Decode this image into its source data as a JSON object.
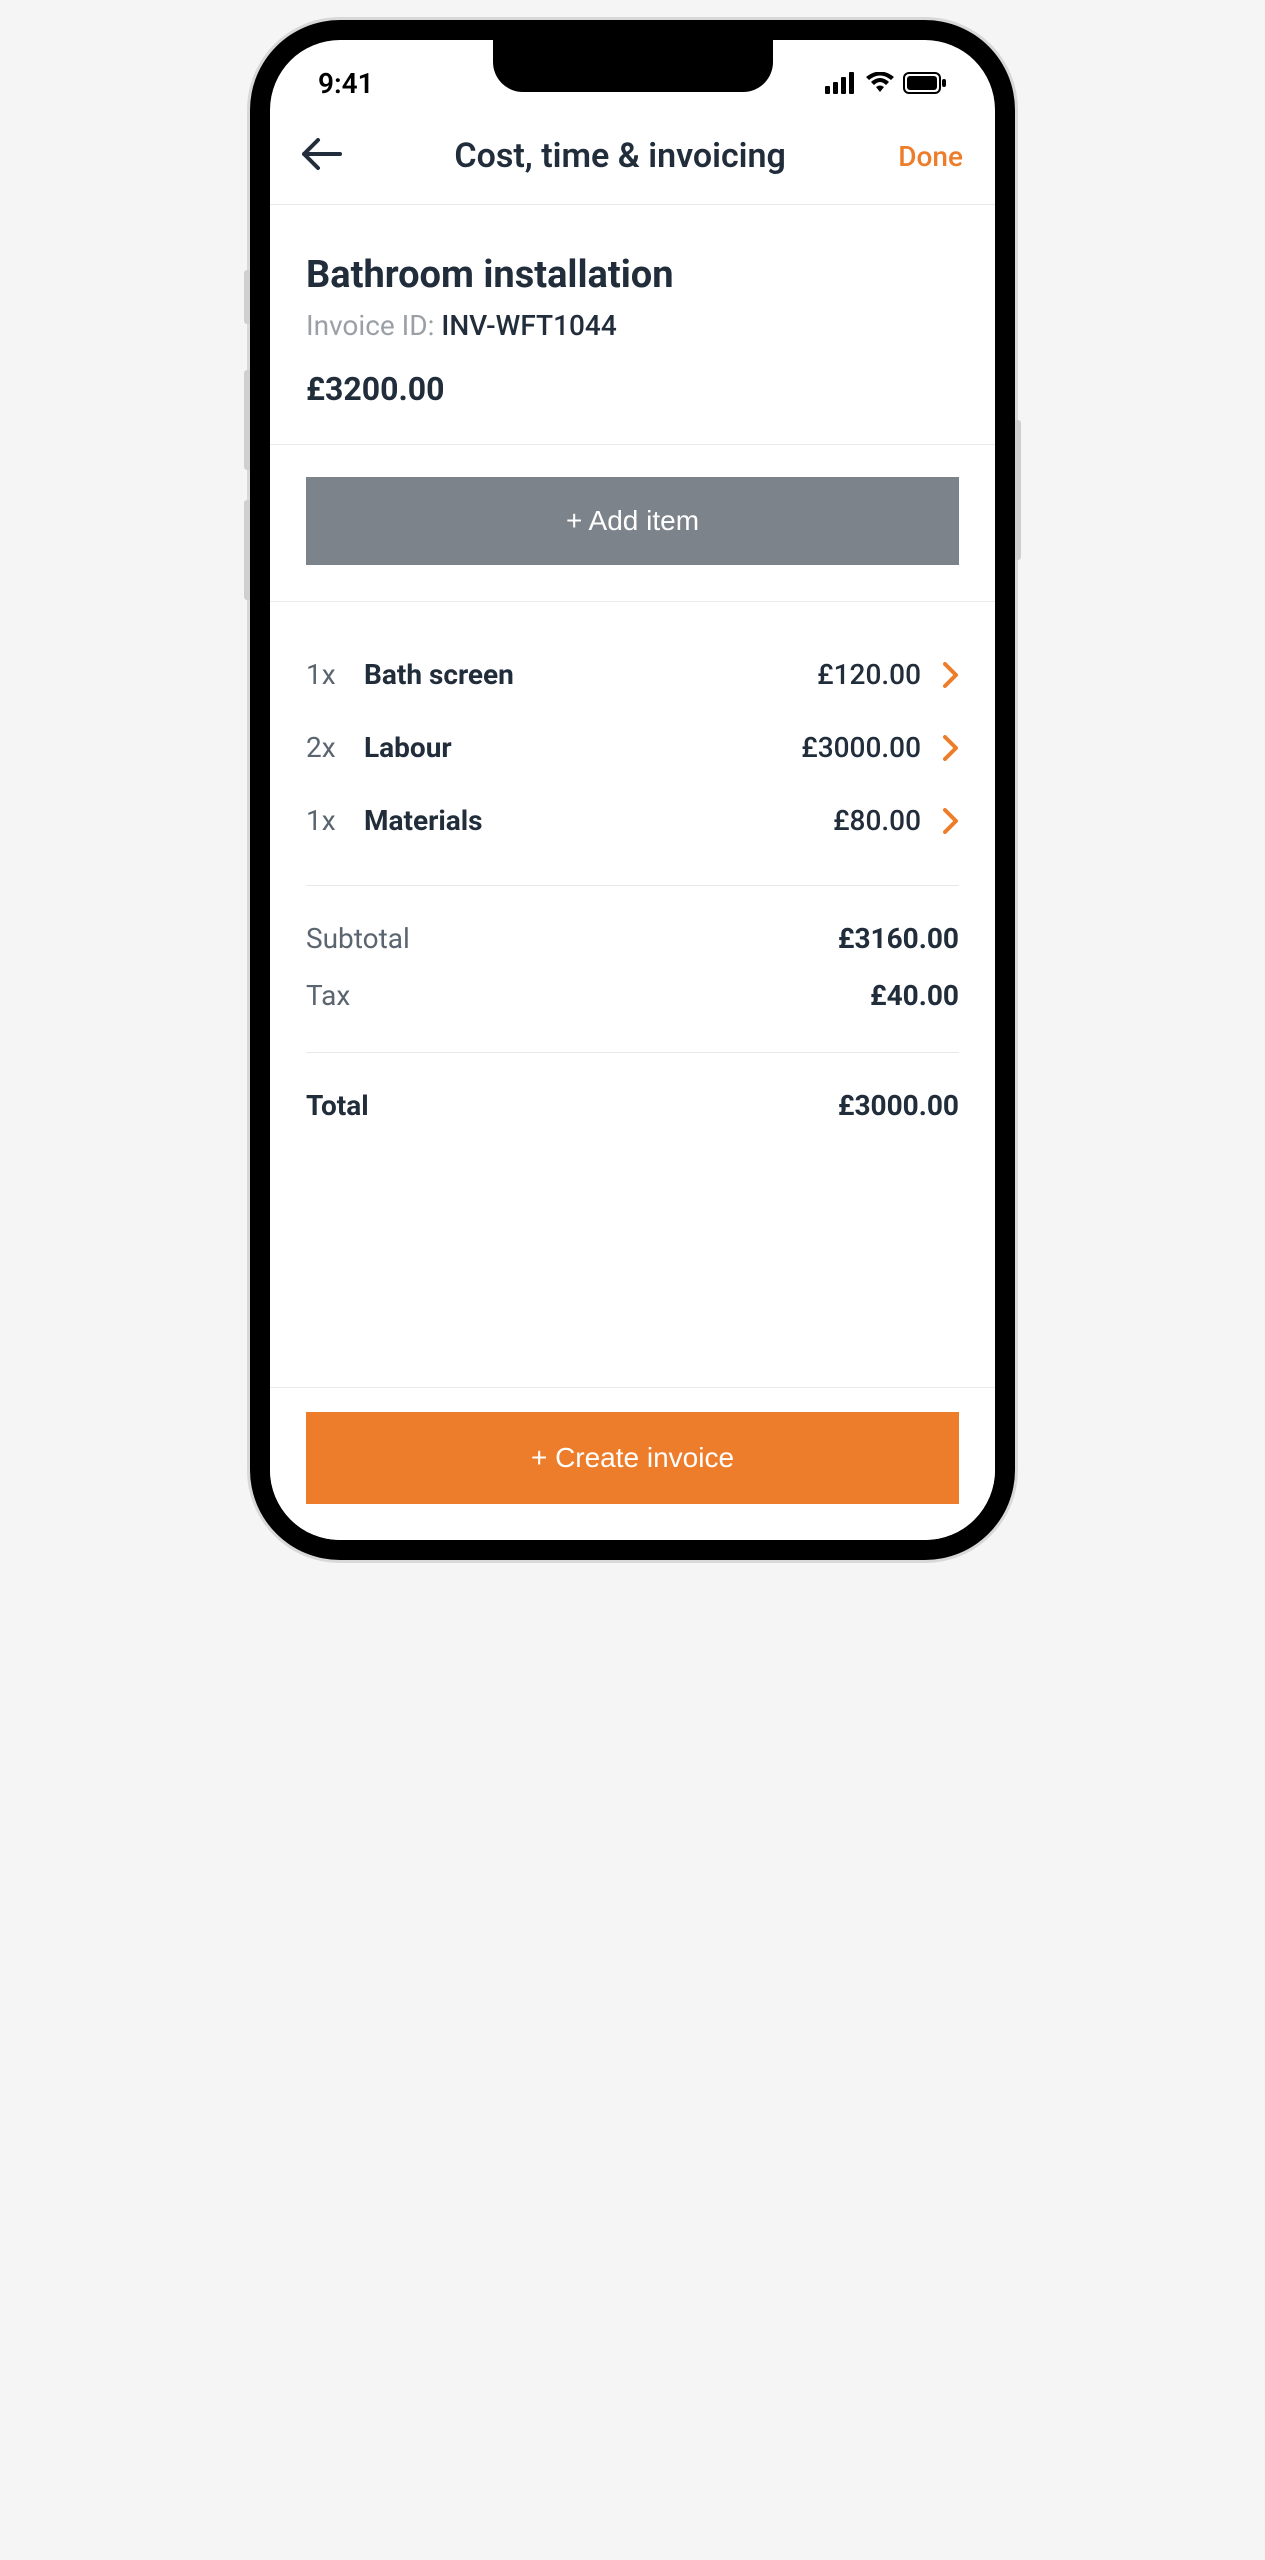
{
  "status": {
    "time": "9:41"
  },
  "header": {
    "title": "Cost, time & invoicing",
    "done_label": "Done"
  },
  "job": {
    "title": "Bathroom installation",
    "invoice_id_label": "Invoice ID:",
    "invoice_id_value": "INV-WFT1044",
    "total": "£3200.00"
  },
  "add_button_label": "+ Add item",
  "items": [
    {
      "qty": "1x",
      "name": "Bath screen",
      "price": "£120.00"
    },
    {
      "qty": "2x",
      "name": "Labour",
      "price": "£3000.00"
    },
    {
      "qty": "1x",
      "name": "Materials",
      "price": "£80.00"
    }
  ],
  "summary": {
    "subtotal_label": "Subtotal",
    "subtotal_value": "£3160.00",
    "tax_label": "Tax",
    "tax_value": "£40.00",
    "total_label": "Total",
    "total_value": "£3000.00"
  },
  "create_button_label": "+ Create invoice"
}
